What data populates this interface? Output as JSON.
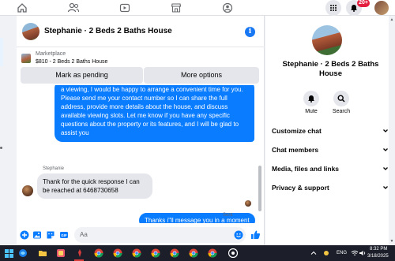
{
  "nav": {
    "notifications_count": "20+"
  },
  "chat": {
    "header_title": "Stephanie · 2 Beds 2 Baths House",
    "marketplace_label": "Marketplace",
    "listing": "$810 - 2 Beds 2 Baths House",
    "mark_pending_label": "Mark as pending",
    "more_options_label": "More options",
    "messages": {
      "outgoing_1": "a viewing, I would be happy to arrange a convenient time for you. Please send me your contact number so I can share the full address, provide more details about the house, and discuss available viewing slots. Let me know if you have any specific questions about the property or its features, and I will be glad to assist you",
      "sender_name": "Stephanie",
      "incoming_1": "Thank for the quick response I can be reached at 6468730658",
      "outgoing_2": "Thanks i\"ll message you in a moment",
      "status": "Sent"
    },
    "composer_placeholder": "Aa"
  },
  "details": {
    "title": "Stephanie · 2 Beds 2 Baths House",
    "mute_label": "Mute",
    "search_label": "Search",
    "rows": [
      "Customize chat",
      "Chat members",
      "Media, files and links",
      "Privacy & support"
    ]
  },
  "taskbar": {
    "language": "ENG",
    "time": "8:32 PM",
    "date": "3/18/2025"
  },
  "colors": {
    "messenger_blue": "#0a7cff",
    "facebook_blue": "#1877f2",
    "badge_red": "#e41e3f"
  }
}
